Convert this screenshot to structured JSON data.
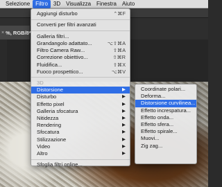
{
  "menubar": {
    "items": [
      "Selezione",
      "Filtro",
      "3D",
      "Visualizza",
      "Finestra",
      "Aiuto"
    ],
    "active_index": 1
  },
  "document": {
    "tab_title": "%, RGB/8*)",
    "close_glyph": "×"
  },
  "filter_menu": {
    "top": [
      {
        "label": "Aggiungi disturbo",
        "shortcut": "⌃⌘F"
      }
    ],
    "convert": "Converti per filtri avanzati",
    "gallery": [
      {
        "label": "Galleria filtri...",
        "shortcut": ""
      },
      {
        "label": "Grandangolo adattato...",
        "shortcut": "⌥⇧⌘A"
      },
      {
        "label": "Filtro Camera Raw...",
        "shortcut": "⇧⌘A"
      },
      {
        "label": "Correzione obiettivo...",
        "shortcut": "⇧⌘R"
      },
      {
        "label": "Fluidifica...",
        "shortcut": "⇧⌘X"
      },
      {
        "label": "Fuoco prospettico...",
        "shortcut": "⌥⌘V"
      }
    ],
    "disabled_3d": "3D",
    "categories": [
      "Distorsione",
      "Disturbo",
      "Effetto pixel",
      "Galleria sfocatura",
      "Nitidezza",
      "Rendering",
      "Sfocatura",
      "Stilizzazione",
      "Video",
      "Altro"
    ],
    "highlighted_category": "Distorsione",
    "arrow_glyph": "▶",
    "online": "Sfoglia filtri online..."
  },
  "distorsione_submenu": {
    "items": [
      "Coordinate polari...",
      "Deforma...",
      "Distorsione curvilinea...",
      "Effetto increspatura...",
      "Effetto onda...",
      "Effetto sfera...",
      "Effetto spirale...",
      "Muovi...",
      "Zig zag..."
    ],
    "highlighted_index": 2
  },
  "colors": {
    "highlight": "#2f6ee6",
    "menu_bg": "#e8e8e8",
    "menubar_bg": "#dcdcdc"
  }
}
